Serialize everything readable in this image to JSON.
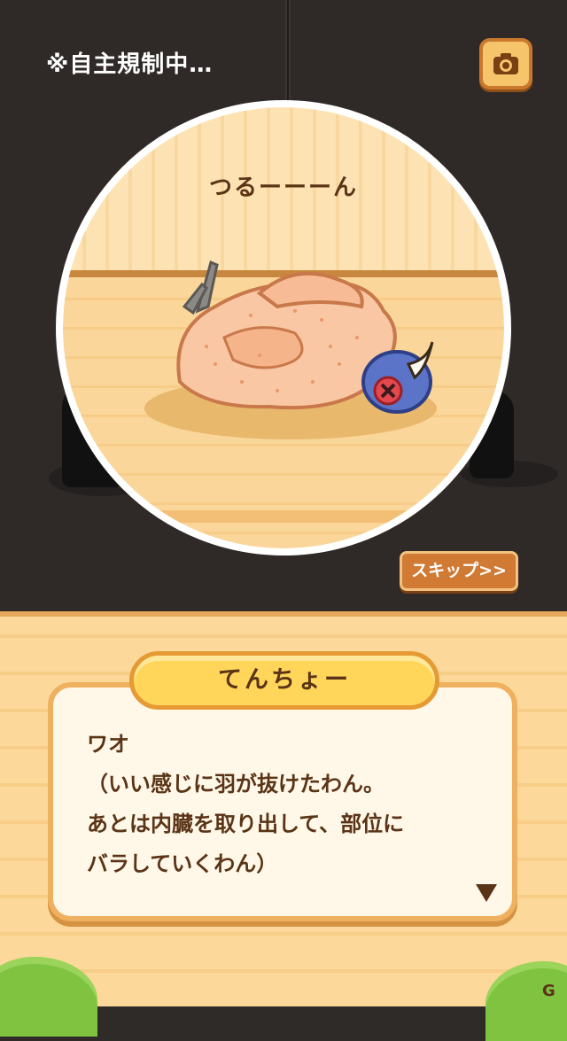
{
  "header": {
    "censor_notice": "※自主規制中…",
    "camera_icon": "camera-icon"
  },
  "scene": {
    "sound_effect": "つるーーーん"
  },
  "controls": {
    "skip_label": "スキップ>>"
  },
  "dialog": {
    "speaker": "てんちょー",
    "text": "ワオ\n（いい感じに羽が抜けたわん。\nあとは内臓を取り出して、部位に\nバラしていくわん）",
    "next_icon": "triangle-down-icon"
  },
  "watermark": "G"
}
